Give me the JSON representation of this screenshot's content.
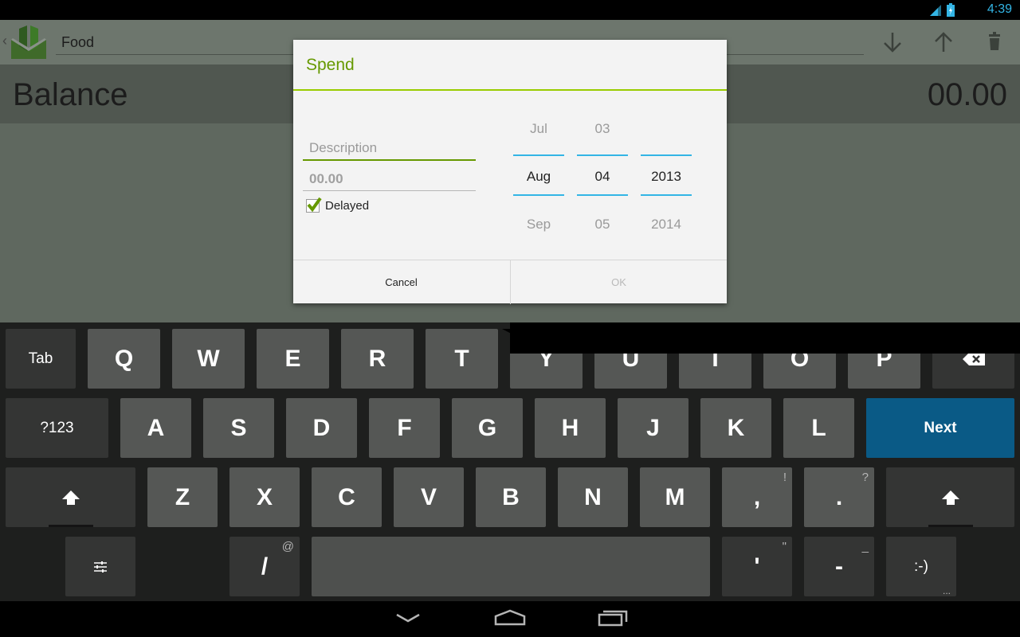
{
  "status": {
    "time": "4:39",
    "network": "3G"
  },
  "app": {
    "account": "Food",
    "balance_label": "Balance",
    "balance_value": "00.00"
  },
  "dialog": {
    "title": "Spend",
    "description_placeholder": "Description",
    "amount_placeholder": "00.00",
    "delayed_label": "Delayed",
    "delayed_checked": true,
    "month": {
      "prev": "Jul",
      "current": "Aug",
      "next": "Sep"
    },
    "day": {
      "prev": "03",
      "current": "04",
      "next": "05"
    },
    "year": {
      "prev": "",
      "current": "2013",
      "next": "2014"
    },
    "cancel": "Cancel",
    "ok": "OK"
  },
  "keyboard": {
    "row1": [
      "Tab",
      "Q",
      "W",
      "E",
      "R",
      "T",
      "Y",
      "U",
      "I",
      "O",
      "P"
    ],
    "row2": [
      "?123",
      "A",
      "S",
      "D",
      "F",
      "G",
      "H",
      "J",
      "K",
      "L",
      "Next"
    ],
    "row3": [
      "Z",
      "X",
      "C",
      "V",
      "B",
      "N",
      "M",
      ",",
      "."
    ],
    "row3_alts": [
      "!",
      "?"
    ],
    "row4": [
      "/",
      "'",
      "-",
      ":-)"
    ],
    "row4_alts": [
      "@",
      "\"",
      "_",
      "..."
    ]
  },
  "colors": {
    "accent_green": "#669900",
    "divider_green": "#99cc00",
    "holo_blue": "#33b5e5",
    "next_key": "#0a5a86"
  }
}
